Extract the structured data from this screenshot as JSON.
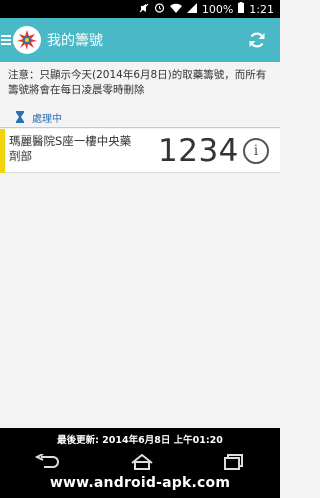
{
  "status_bar": {
    "battery": "100%",
    "time": "1:21"
  },
  "app_bar": {
    "title": "我的籌號"
  },
  "notice": {
    "text": "注意：只顯示今天(2014年6月8日)的取藥籌號，而所有籌號將會在每日凌晨零時刪除"
  },
  "section": {
    "label": "處理中"
  },
  "tickets": [
    {
      "location": "瑪麗醫院S座一樓中央藥劑部",
      "number": "1234",
      "status_color": "#f1d40a"
    }
  ],
  "footer": {
    "last_updated": "最後更新: 2014年6月8日 上午01:20"
  },
  "watermark": {
    "text": "www.android-apk.com"
  },
  "colors": {
    "app_bar": "#49b9c8",
    "section_text": "#2c6fb5"
  }
}
